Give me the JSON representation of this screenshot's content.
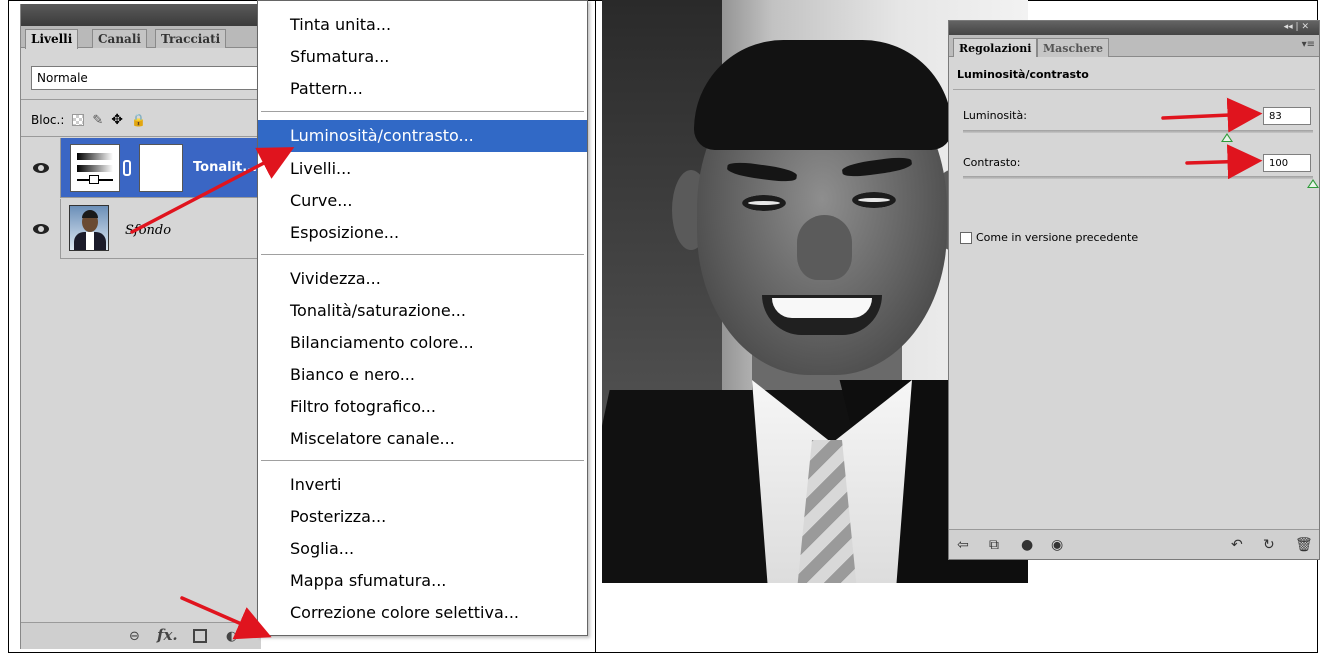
{
  "layers_panel": {
    "tabs": [
      "Livelli",
      "Canali",
      "Tracciati"
    ],
    "blend_mode": "Normale",
    "lock_label": "Bloc.:",
    "layers": [
      {
        "name": "Tonalit...",
        "selected": true,
        "visible": true,
        "type": "adjustment"
      },
      {
        "name": "Sfondo",
        "selected": false,
        "visible": true,
        "type": "photo"
      }
    ]
  },
  "menu": {
    "groups": [
      [
        "Tinta unita...",
        "Sfumatura...",
        "Pattern..."
      ],
      [
        "Luminosità/contrasto...",
        "Livelli...",
        "Curve...",
        "Esposizione..."
      ],
      [
        "Vividezza...",
        "Tonalità/saturazione...",
        "Bilanciamento colore...",
        "Bianco e nero...",
        "Filtro fotografico...",
        "Miscelatore canale..."
      ],
      [
        "Inverti",
        "Posterizza...",
        "Soglia...",
        "Mappa sfumatura...",
        "Correzione colore selettiva..."
      ]
    ],
    "highlighted": "Luminosità/contrasto..."
  },
  "adjustments_panel": {
    "tabs": [
      "Regolazioni",
      "Maschere"
    ],
    "title": "Luminosità/contrasto",
    "brightness": {
      "label": "Luminosità:",
      "value": "83"
    },
    "contrast": {
      "label": "Contrasto:",
      "value": "100"
    },
    "legacy_checkbox": {
      "label": "Come in versione precedente",
      "checked": false
    }
  },
  "colors": {
    "menu_highlight": "#3169c6",
    "layer_selected": "#3a66c4",
    "panel_bg": "#d6d6d6",
    "arrow": "#e0141e",
    "slider_thumb": "#2e9a3a"
  },
  "icons": [
    "eye-icon",
    "chain-icon",
    "link-layers-icon",
    "fx-icon",
    "mask-icon",
    "adjustment-layer-icon",
    "new-group-icon",
    "new-layer-icon",
    "trash-icon",
    "lock-transparency-icon",
    "lock-brush-icon",
    "lock-move-icon",
    "lock-all-icon"
  ]
}
